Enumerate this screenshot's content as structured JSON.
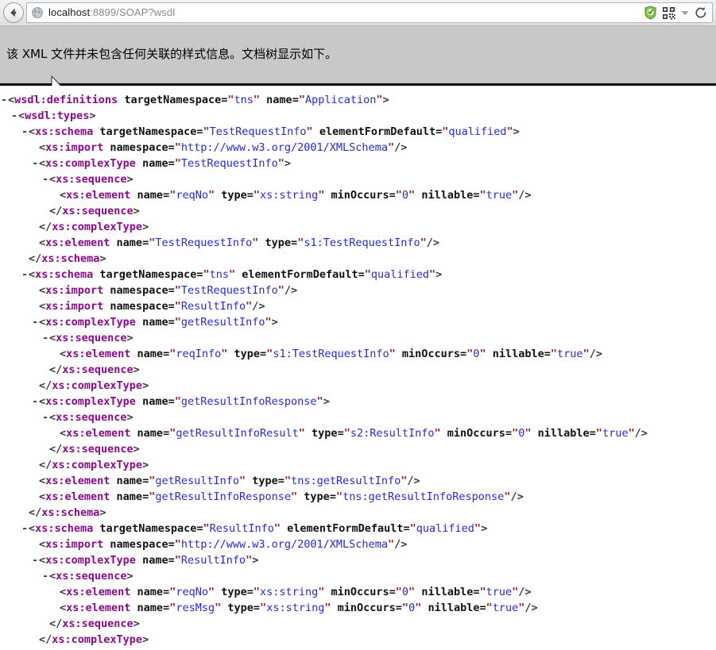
{
  "browser": {
    "back_button_label": "Back",
    "back_icon": "arrow-left-icon",
    "favicon": "globe-icon",
    "url_host": "localhost",
    "url_rest": ":8899/SOAP?wsdl",
    "url_full": "localhost:8899/SOAP?wsdl",
    "icons": [
      {
        "name": "shield-icon",
        "label": "Security shield",
        "color": "#6cc24a"
      },
      {
        "name": "qr-code-icon",
        "label": "QR code",
        "color": "#3a3a3a"
      },
      {
        "name": "chevron-down-icon",
        "label": "More",
        "color": "#9a9a9a"
      },
      {
        "name": "reload-icon",
        "label": "Reload",
        "color": "#4a4a4a"
      }
    ]
  },
  "notice": {
    "text": "该 XML 文件并未包含任何关联的样式信息。文档树显示如下。",
    "background": "#c8c8c8",
    "cursor": "mouse-pointer-icon"
  },
  "colors": {
    "tag_name": "#8b0a8b",
    "attribute_name": "#111111",
    "attribute_value": "#2727e0",
    "quote": "#9b2020",
    "bracket": "#3a3a3a",
    "page_background": "#ffffff"
  },
  "xml_tree": {
    "lines": [
      {
        "indent": 0,
        "twisty": "-",
        "type": "open",
        "tag": "wsdl:definitions",
        "attrs": [
          {
            "name": "targetNamespace",
            "value": "tns"
          },
          {
            "name": "name",
            "value": "Application"
          }
        ]
      },
      {
        "indent": 1,
        "twisty": "-",
        "type": "open",
        "tag": "wsdl:types",
        "attrs": []
      },
      {
        "indent": 2,
        "twisty": "-",
        "type": "open",
        "tag": "xs:schema",
        "attrs": [
          {
            "name": "targetNamespace",
            "value": "TestRequestInfo"
          },
          {
            "name": "elementFormDefault",
            "value": "qualified"
          }
        ]
      },
      {
        "indent": 3,
        "twisty": "",
        "type": "self",
        "tag": "xs:import",
        "attrs": [
          {
            "name": "namespace",
            "value": "http://www.w3.org/2001/XMLSchema"
          }
        ]
      },
      {
        "indent": 3,
        "twisty": "-",
        "type": "open",
        "tag": "xs:complexType",
        "attrs": [
          {
            "name": "name",
            "value": "TestRequestInfo"
          }
        ]
      },
      {
        "indent": 4,
        "twisty": "-",
        "type": "open",
        "tag": "xs:sequence",
        "attrs": []
      },
      {
        "indent": 5,
        "twisty": "",
        "type": "self",
        "tag": "xs:element",
        "attrs": [
          {
            "name": "name",
            "value": "reqNo"
          },
          {
            "name": "type",
            "value": "xs:string"
          },
          {
            "name": "minOccurs",
            "value": "0"
          },
          {
            "name": "nillable",
            "value": "true"
          }
        ]
      },
      {
        "indent": 4,
        "twisty": "",
        "type": "close",
        "tag": "xs:sequence",
        "attrs": []
      },
      {
        "indent": 3,
        "twisty": "",
        "type": "close",
        "tag": "xs:complexType",
        "attrs": []
      },
      {
        "indent": 3,
        "twisty": "",
        "type": "self",
        "tag": "xs:element",
        "attrs": [
          {
            "name": "name",
            "value": "TestRequestInfo"
          },
          {
            "name": "type",
            "value": "s1:TestRequestInfo"
          }
        ]
      },
      {
        "indent": 2,
        "twisty": "",
        "type": "close",
        "tag": "xs:schema",
        "attrs": []
      },
      {
        "indent": 2,
        "twisty": "-",
        "type": "open",
        "tag": "xs:schema",
        "attrs": [
          {
            "name": "targetNamespace",
            "value": "tns"
          },
          {
            "name": "elementFormDefault",
            "value": "qualified"
          }
        ]
      },
      {
        "indent": 3,
        "twisty": "",
        "type": "self",
        "tag": "xs:import",
        "attrs": [
          {
            "name": "namespace",
            "value": "TestRequestInfo"
          }
        ]
      },
      {
        "indent": 3,
        "twisty": "",
        "type": "self",
        "tag": "xs:import",
        "attrs": [
          {
            "name": "namespace",
            "value": "ResultInfo"
          }
        ]
      },
      {
        "indent": 3,
        "twisty": "-",
        "type": "open",
        "tag": "xs:complexType",
        "attrs": [
          {
            "name": "name",
            "value": "getResultInfo"
          }
        ]
      },
      {
        "indent": 4,
        "twisty": "-",
        "type": "open",
        "tag": "xs:sequence",
        "attrs": []
      },
      {
        "indent": 5,
        "twisty": "",
        "type": "self",
        "tag": "xs:element",
        "attrs": [
          {
            "name": "name",
            "value": "reqInfo"
          },
          {
            "name": "type",
            "value": "s1:TestRequestInfo"
          },
          {
            "name": "minOccurs",
            "value": "0"
          },
          {
            "name": "nillable",
            "value": "true"
          }
        ]
      },
      {
        "indent": 4,
        "twisty": "",
        "type": "close",
        "tag": "xs:sequence",
        "attrs": []
      },
      {
        "indent": 3,
        "twisty": "",
        "type": "close",
        "tag": "xs:complexType",
        "attrs": []
      },
      {
        "indent": 3,
        "twisty": "-",
        "type": "open",
        "tag": "xs:complexType",
        "attrs": [
          {
            "name": "name",
            "value": "getResultInfoResponse"
          }
        ]
      },
      {
        "indent": 4,
        "twisty": "-",
        "type": "open",
        "tag": "xs:sequence",
        "attrs": []
      },
      {
        "indent": 5,
        "twisty": "",
        "type": "self",
        "tag": "xs:element",
        "attrs": [
          {
            "name": "name",
            "value": "getResultInfoResult"
          },
          {
            "name": "type",
            "value": "s2:ResultInfo"
          },
          {
            "name": "minOccurs",
            "value": "0"
          },
          {
            "name": "nillable",
            "value": "true"
          }
        ]
      },
      {
        "indent": 4,
        "twisty": "",
        "type": "close",
        "tag": "xs:sequence",
        "attrs": []
      },
      {
        "indent": 3,
        "twisty": "",
        "type": "close",
        "tag": "xs:complexType",
        "attrs": []
      },
      {
        "indent": 3,
        "twisty": "",
        "type": "self",
        "tag": "xs:element",
        "attrs": [
          {
            "name": "name",
            "value": "getResultInfo"
          },
          {
            "name": "type",
            "value": "tns:getResultInfo"
          }
        ]
      },
      {
        "indent": 3,
        "twisty": "",
        "type": "self",
        "tag": "xs:element",
        "attrs": [
          {
            "name": "name",
            "value": "getResultInfoResponse"
          },
          {
            "name": "type",
            "value": "tns:getResultInfoResponse"
          }
        ]
      },
      {
        "indent": 2,
        "twisty": "",
        "type": "close",
        "tag": "xs:schema",
        "attrs": []
      },
      {
        "indent": 2,
        "twisty": "-",
        "type": "open",
        "tag": "xs:schema",
        "attrs": [
          {
            "name": "targetNamespace",
            "value": "ResultInfo"
          },
          {
            "name": "elementFormDefault",
            "value": "qualified"
          }
        ]
      },
      {
        "indent": 3,
        "twisty": "",
        "type": "self",
        "tag": "xs:import",
        "attrs": [
          {
            "name": "namespace",
            "value": "http://www.w3.org/2001/XMLSchema"
          }
        ]
      },
      {
        "indent": 3,
        "twisty": "-",
        "type": "open",
        "tag": "xs:complexType",
        "attrs": [
          {
            "name": "name",
            "value": "ResultInfo"
          }
        ]
      },
      {
        "indent": 4,
        "twisty": "-",
        "type": "open",
        "tag": "xs:sequence",
        "attrs": []
      },
      {
        "indent": 5,
        "twisty": "",
        "type": "self",
        "tag": "xs:element",
        "attrs": [
          {
            "name": "name",
            "value": "reqNo"
          },
          {
            "name": "type",
            "value": "xs:string"
          },
          {
            "name": "minOccurs",
            "value": "0"
          },
          {
            "name": "nillable",
            "value": "true"
          }
        ]
      },
      {
        "indent": 5,
        "twisty": "",
        "type": "self",
        "tag": "xs:element",
        "attrs": [
          {
            "name": "name",
            "value": "resMsg"
          },
          {
            "name": "type",
            "value": "xs:string"
          },
          {
            "name": "minOccurs",
            "value": "0"
          },
          {
            "name": "nillable",
            "value": "true"
          }
        ]
      },
      {
        "indent": 4,
        "twisty": "",
        "type": "close",
        "tag": "xs:sequence",
        "attrs": []
      },
      {
        "indent": 3,
        "twisty": "",
        "type": "close",
        "tag": "xs:complexType",
        "attrs": []
      }
    ]
  }
}
